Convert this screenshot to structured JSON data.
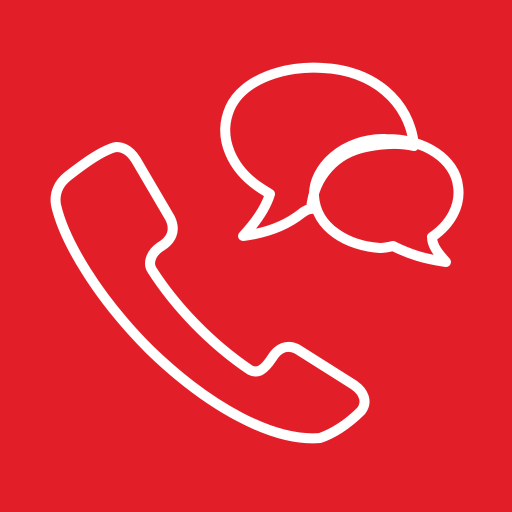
{
  "icon": {
    "name": "phone-chat-app-icon",
    "background_color": "#e21f29",
    "stroke_color": "#ffffff",
    "glyphs": [
      "phone-handset-icon",
      "speech-bubbles-icon"
    ]
  }
}
